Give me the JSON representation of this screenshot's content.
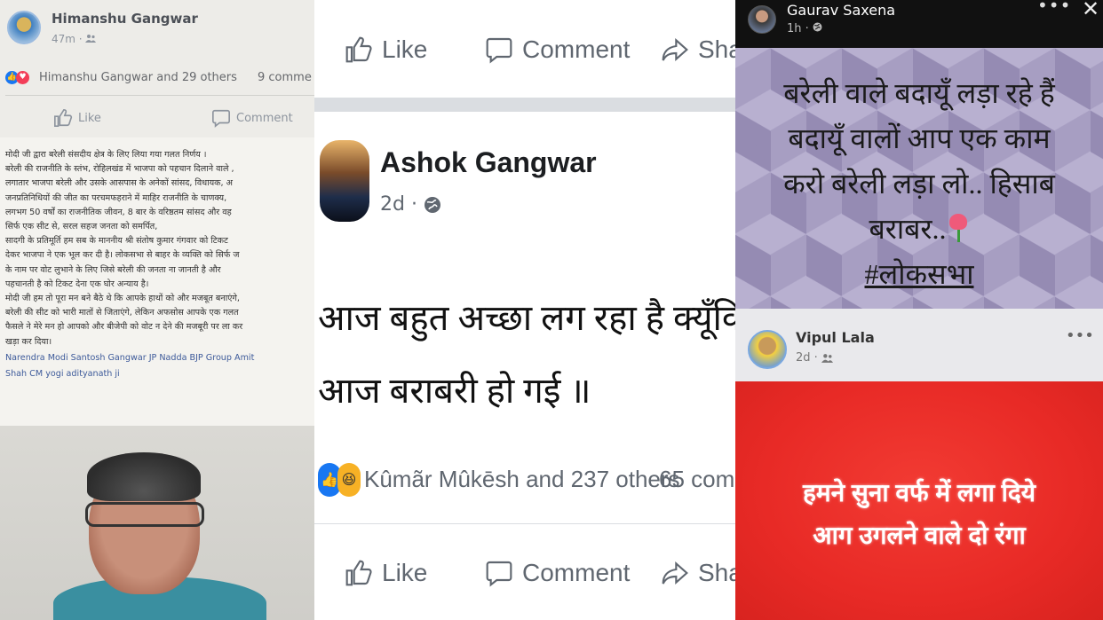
{
  "panel1": {
    "author": "Himanshu Gangwar",
    "time": "47m",
    "reactions_text": "Himanshu Gangwar and 29 others",
    "comments_count": "9 comme",
    "like_label": "Like",
    "comment_label": "Comment",
    "document_lines": [
      "मोदी जी द्वारा बरेली संसदीय क्षेत्र के लिए लिया गया गलत निर्णय ।",
      "बरेली की राजनीति के स्तंभ, रोहिलखंड में भाजपा को पहचान दिलाने वाले ,",
      "लगातार भाजपा बरेली और उसके आसपास के अनेकों सांसद, विधायक, अ",
      "जनप्रतिनिधियों की जीत का परचमफहराने में माहिर राजनीति के चाणक्य,",
      "लगभग 50 वर्षों का राजनीतिक जीवन, 8 बार के वरिष्ठतम सांसद और वह",
      "सिर्फ एक सीट से, सरल सहज जनता को समर्पित,",
      "सादगी के प्रतिमूर्ति हम सब के माननीय श्री संतोष कुमार गंगवार को टिकट",
      "देकर भाजपा ने एक भूल कर दी है। लोकसभा से बाहर के व्यक्ति को सिर्फ ज",
      "के नाम पर वोट लुभाने के लिए जिसे बरेली की जनता ना जानती है और",
      "पहचानती है को टिकट देना एक घोर अन्याय है।",
      "मोदी जी हम तो पूरा मन बने बैठे थे कि आपके हाथों को और मजबूत बनाएंगे,",
      "बरेली की सीट को भारी मातों से जिताएंगे, लेकिन अफसोस आपके एक गलत",
      "फैसले ने मेरे मन हो आपको और बीजेपी को वोट न देने की मजबूरी पर ला कर",
      "खड़ा कर दिया।"
    ],
    "tags_lines": [
      "Narendra Modi Santosh Gangwar JP Nadda BJP Group Amit",
      "Shah CM yogi adityanath ji"
    ]
  },
  "panel2": {
    "like_label": "Like",
    "comment_label": "Comment",
    "share_label": "Share",
    "author": "Ashok Gangwar",
    "time": "2d",
    "post_lines": [
      "आज बहुत अच्छा लग रहा है क्यूँकि",
      "आज बराबरी हो गई ॥"
    ],
    "reactions_text": "Kûmãr Mûkēsh and 237 others",
    "comments_count": "65 comm"
  },
  "panel3": {
    "author": "Gaurav Saxena",
    "time": "1h",
    "story_lines": [
      "बरेली वाले बदायूँ लड़ा रहे हैं",
      "बदायूँ वालों आप एक काम",
      "करो बरेली लड़ा लो.. हिसाब",
      "बराबर.."
    ],
    "hashtag": "#लोकसभा",
    "second_author": "Vipul Lala",
    "second_time": "2d",
    "red_text_lines": [
      "हमने सुना वर्फ में लगा दिये",
      "आग उगलने वाले दो रंगा"
    ]
  },
  "colors": {
    "facebook_blue": "#1877f2",
    "love_red": "#f33e58",
    "story_purple": "#a79ec2",
    "red_bg": "#e82a26"
  },
  "icons": [
    "like-icon",
    "comment-icon",
    "share-icon",
    "globe-icon",
    "friends-icon",
    "more-icon",
    "close-icon"
  ]
}
